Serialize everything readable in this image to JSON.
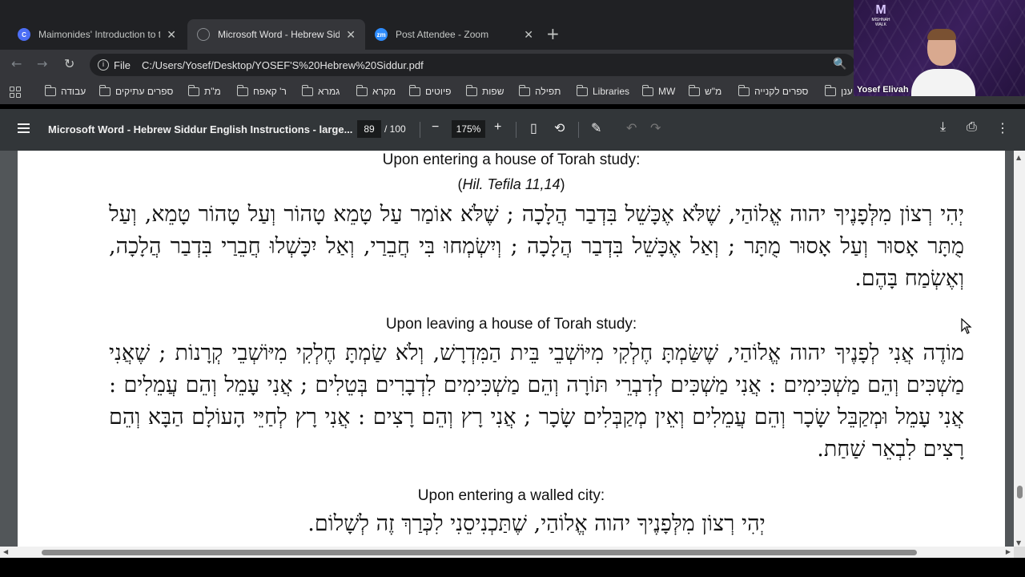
{
  "tabs": [
    {
      "title": "Maimonides' Introduction to the",
      "favicon": "C",
      "favicon_color": "#4c6ef5"
    },
    {
      "title": "Microsoft Word - Hebrew Siddu",
      "favicon": "globe-icon",
      "favicon_color": "#8a8d91"
    },
    {
      "title": "Post Attendee - Zoom",
      "favicon": "zm",
      "favicon_color": "#2d8cff"
    }
  ],
  "address": {
    "scheme": "File",
    "url": "C:/Users/Yosef/Desktop/YOSEF'S%20Hebrew%20Siddur.pdf"
  },
  "bookmarks": [
    "עבודה",
    "ספרים עתיקים",
    "מ\"ת",
    "ר' קאפח",
    "גמרא",
    "מקרא",
    "פיוטים",
    "שפות",
    "תפילה",
    "Libraries",
    "MW",
    "מ\"ש",
    "ספרים לקנייה",
    "ענן"
  ],
  "pdf_toolbar": {
    "title": "Microsoft Word - Hebrew Siddur English Instructions - large...",
    "page": "89",
    "total": "/ 100",
    "zoom": "175%"
  },
  "document": {
    "section1_heading": "Upon entering a house of Torah study:",
    "section1_cite_open": "(",
    "section1_cite": "Hil. Tefila 11,14",
    "section1_cite_close": ")",
    "section1_text": "יְהִי רְצוֹן מִלְּפָנֶיךָ יהוה אֱלוֹהַי, שֶׁלֹּא אֶכָּשֵׁל בִּדְבַר הֲלָכָה ; שֶׁלֹּא אוֹמַר עַל טָמֵא טָהוֹר וְעַל טָהוֹר טָמֵא, וְעַל מֻתָּר אָסוּר וְעַל אָסוּר מֻתָּר ; וְאַל אֶכָּשֵׁל בִּדְבַר הֲלָכָה ; וְיִשְׂמְחוּ בִּי חֲבֵרַי, וְאַל יִכָּשְׁלוּ חֲבֵרַי בִּדְבַר הֲלָכָה, וְאֶשְׂמַח בָּהֶם.",
    "section2_heading": "Upon leaving a house of Torah study:",
    "section2_text": "מוֹדֶה אֲנִי לְפָנֶיךָ יהוה אֱלוֹהַי, שֶׁשַּׂמְתָּ חֶלְקִי מִיּוֹשְׁבֵי בֵּית הַמִּדְרָשׁ, וְלֹא שַׂמְתָּ חֶלְקִי מִיּוֹשְׁבֵי קְרָנוֹת ; שֶׁאֲנִי מַשְׁכִּים וְהֵם מַשְׁכִּימִים : אֲנִי מַשְׁכִּים לְדִבְרֵי תּוֹרָה וְהֵם מַשְׁכִּימִים לִדְבָרִים בְּטֵלִים ; אֲנִי עָמֵל וְהֵם עֲמֵלִים : אֲנִי עָמֵל וּמְקַבֵּל שָׂכָר וְהֵם עֲמֵלִים וְאֵין מְקַבְּלִים שָׂכָר ; אֲנִי רָץ וְהֵם רָצִים : אֲנִי רָץ לְחַיֵּי הָעוֹלָם הַבָּא וְהֵם רָצִים לִבְאֵר שַׁחַת.",
    "section3_heading": "Upon entering a walled city:",
    "section3_text": "יְהִי רְצוֹן מִלְּפָנֶיךָ יהוה אֱלוֹהַי, שֶׁתַּכְנִיסֵנִי לִכְּרַךְ זֶה לְשָׁלוֹם."
  },
  "scroll": {
    "vertical_position": 0.89,
    "horizontal_thumb_fraction": 0.91
  },
  "video": {
    "name": "Yosef Elivah",
    "logo_mark": "M",
    "logo_text": "MISHNAH WALK"
  },
  "colors": {
    "tabstrip": "#202124",
    "toolbar": "#35363a",
    "pdf_toolbar": "#323639",
    "viewer_bg": "#525659",
    "zoom_blue": "#2d8cff"
  }
}
